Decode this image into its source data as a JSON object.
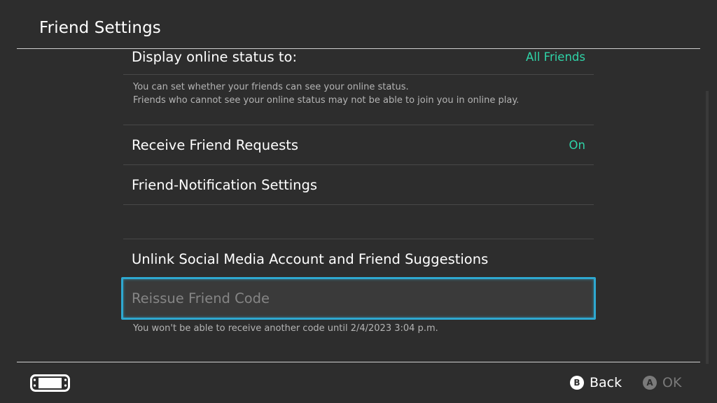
{
  "header": {
    "title": "Friend Settings"
  },
  "settings": {
    "online_status": {
      "label": "Display online status to:",
      "value": "All Friends"
    },
    "online_status_desc": {
      "line1": "You can set whether your friends can see your online status.",
      "line2": "Friends who cannot see your online status may not be able to join you in online play."
    },
    "friend_requests": {
      "label": "Receive Friend Requests",
      "value": "On"
    },
    "notification_settings": {
      "label": "Friend-Notification Settings"
    },
    "unlink_social": {
      "label": "Unlink Social Media Account and Friend Suggestions"
    },
    "reissue_code": {
      "label": "Reissue Friend Code",
      "note": "You won't be able to receive another code until 2/4/2023 3:04 p.m."
    }
  },
  "footer": {
    "back": {
      "button": "B",
      "label": "Back"
    },
    "ok": {
      "button": "A",
      "label": "OK"
    }
  },
  "colors": {
    "accent_value": "#2fd4a8",
    "selection_border": "#2ea8d0",
    "background": "#2d2d2d"
  },
  "icons": {
    "console": "handheld-console-icon"
  }
}
